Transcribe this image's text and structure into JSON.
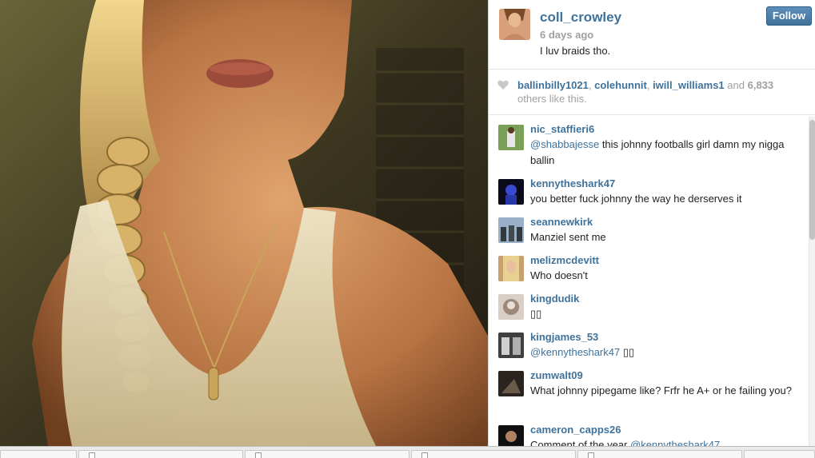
{
  "post": {
    "owner_username": "coll_crowley",
    "time_ago": "6 days ago",
    "caption": "I luv braids tho.",
    "follow_label": "Follow"
  },
  "likes": {
    "users": [
      "ballinbilly1021",
      "colehunnit",
      "iwill_williams1"
    ],
    "and_text": "and",
    "count": "6,833",
    "suffix": "others like this."
  },
  "comments": [
    {
      "username": "nic_staffieri6",
      "mention": "@shabbajesse",
      "text": " this johnny footballs girl damn my nigga ballin"
    },
    {
      "username": "kennytheshark47",
      "mention": "",
      "text": "you better fuck johnny the way he derserves it"
    },
    {
      "username": "seannewkirk",
      "mention": "",
      "text": "Manziel sent me"
    },
    {
      "username": "melizmcdevitt",
      "mention": "",
      "text": "Who doesn't"
    },
    {
      "username": "kingdudik",
      "mention": "",
      "text": "▯▯"
    },
    {
      "username": "kingjames_53",
      "mention": "@kennytheshark47",
      "text": " ▯▯"
    },
    {
      "username": "zumwalt09",
      "mention": "",
      "text": "What johnny pipegame like? Frfr he A+ or he failing you?"
    },
    {
      "username": "cameron_capps26",
      "mention": "@kennytheshark47",
      "text": "Comment of the year "
    }
  ],
  "icons": {
    "heart": "heart-icon",
    "follow": "follow-button"
  },
  "colors": {
    "link_blue": "#3f729b",
    "muted_gray": "#a0a0a0",
    "follow_button": "#3f729b"
  }
}
